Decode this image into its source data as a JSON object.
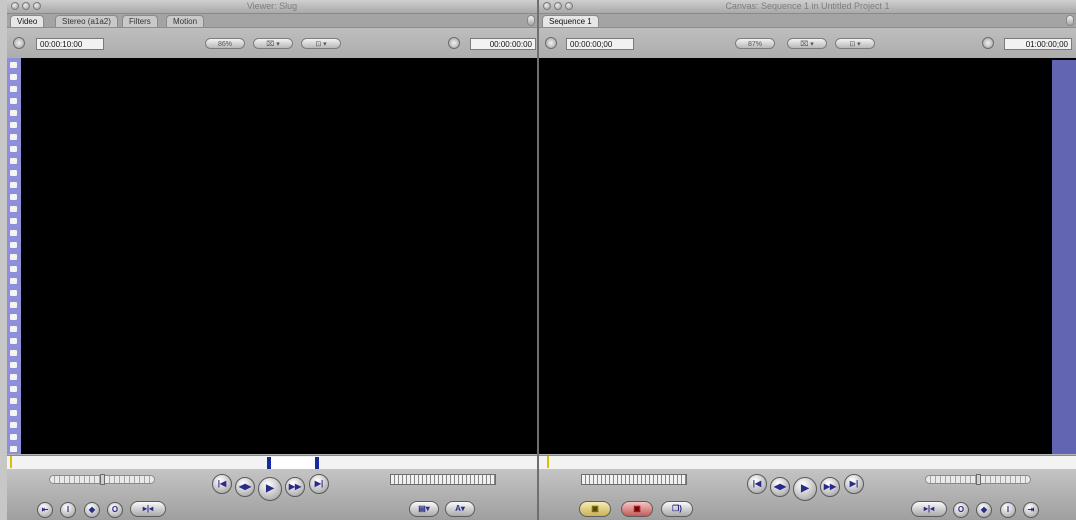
{
  "viewer": {
    "title": "Viewer: Slug",
    "tabs": [
      "Video",
      "Stereo (a1a2)",
      "Filters",
      "Motion"
    ],
    "duration_timecode": "00:00:10:00",
    "zoom": "86%",
    "current_timecode": "00:00:00:00"
  },
  "canvas": {
    "title": "Canvas: Sequence 1 in Untitled Project 1",
    "tabs": [
      "Sequence 1"
    ],
    "duration_timecode": "00:00:00;00",
    "zoom": "87%",
    "current_timecode": "01:00:00;00"
  },
  "colors": {
    "video_bg": "#000000",
    "filmstrip": "#8f8fd9",
    "canvas_edge_bar": "#6266b2",
    "marker_blue": "#1a2a9c",
    "playhead_yellow": "#d6c200"
  },
  "icons": {
    "view_options": "view-options-icon",
    "overlay": "overlay-icon",
    "play": "play-icon",
    "prev_edit": "previous-edit-icon",
    "next_edit": "next-edit-icon",
    "play_in_to_out": "play-in-to-out-icon",
    "mark_in": "mark-in-icon",
    "mark_out": "mark-out-icon"
  }
}
